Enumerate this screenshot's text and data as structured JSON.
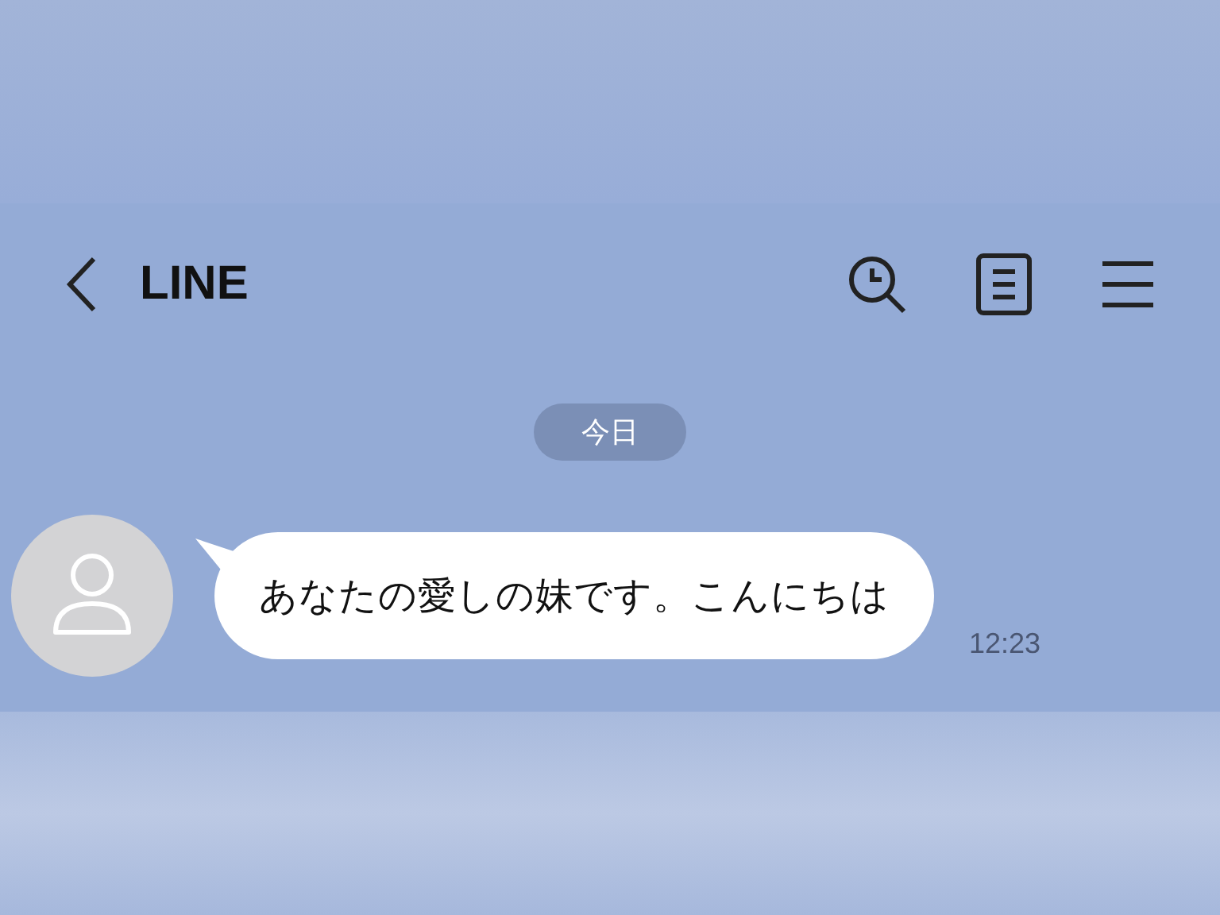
{
  "header": {
    "title": "LINE"
  },
  "date_label": "今日",
  "messages": [
    {
      "text": "あなたの愛しの妹です。こんにちは",
      "time": "12:23"
    }
  ]
}
